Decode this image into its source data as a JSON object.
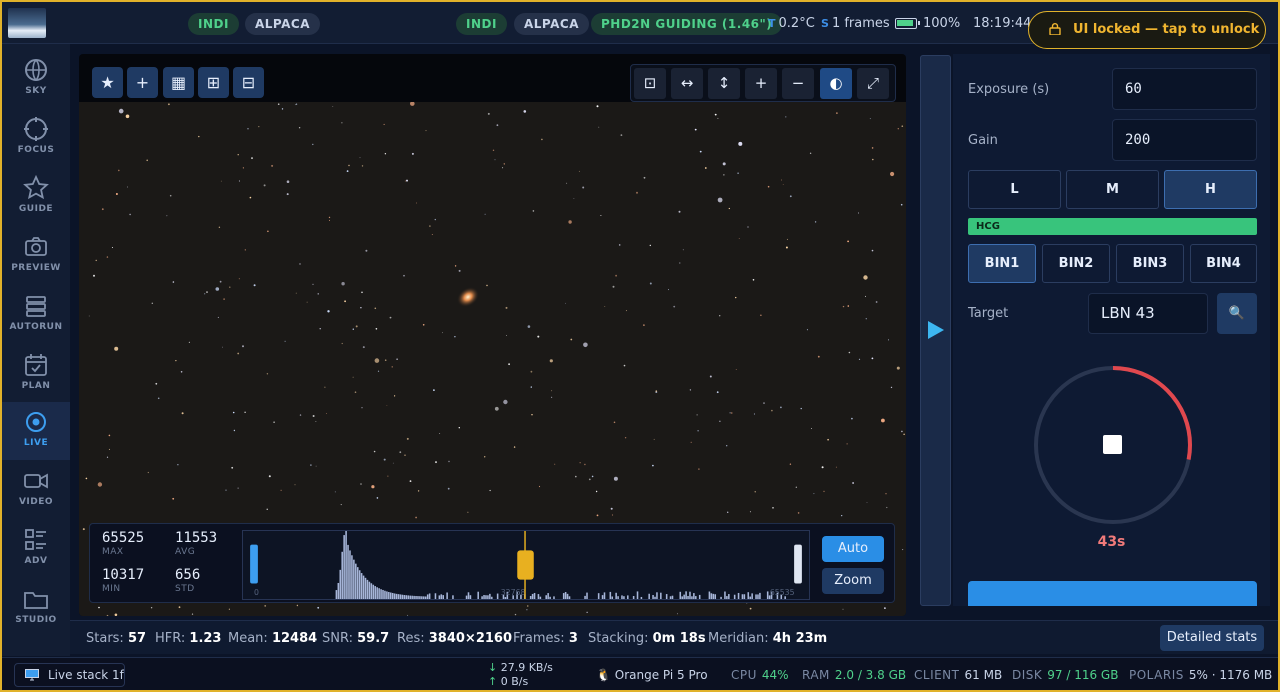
{
  "topbar": {
    "pills_left": [
      "INDI",
      "ALPACA"
    ],
    "pills_right": [
      "INDI",
      "ALPACA",
      "PHD2N GUIDING (1.46\")"
    ],
    "temp_key": "T",
    "temp": "0.2°C",
    "frames_key": "S",
    "frames": "1 frames",
    "battery": "100%",
    "time": "18:19:44",
    "lock_label": "UI locked — tap to unlock"
  },
  "sidebar": {
    "items": [
      {
        "label": "SKY",
        "icon": "globe-icon"
      },
      {
        "label": "FOCUS",
        "icon": "focus-icon"
      },
      {
        "label": "GUIDE",
        "icon": "star-icon"
      },
      {
        "label": "PREVIEW",
        "icon": "camera-icon"
      },
      {
        "label": "AUTORUN",
        "icon": "stack-icon"
      },
      {
        "label": "PLAN",
        "icon": "calendar-icon"
      },
      {
        "label": "LIVE",
        "icon": "target-icon"
      },
      {
        "label": "VIDEO",
        "icon": "video-icon"
      },
      {
        "label": "ADV",
        "icon": "list-icon"
      },
      {
        "label": "STUDIO",
        "icon": "folder-icon"
      }
    ],
    "active": "LIVE"
  },
  "image_toolbar": {
    "left": [
      "★",
      "+",
      "▦",
      "⊞",
      "⊟"
    ],
    "right": [
      "⊡",
      "↔",
      "↕",
      "+",
      "−",
      "◐",
      "⤢"
    ]
  },
  "histogram": {
    "max_value": "65525",
    "max_label": "MAX",
    "avg_value": "11553",
    "avg_label": "AVG",
    "min_value": "10317",
    "min_label": "MIN",
    "std_value": "656",
    "std_label": "STD",
    "axis_min": "0",
    "axis_mid": "32768",
    "axis_max": "65535",
    "auto_label": "Auto",
    "zoom_label": "Zoom"
  },
  "stats": {
    "stars_label": "Stars:",
    "stars": "57",
    "hfr_label": "HFR:",
    "hfr": "1.23",
    "mean_label": "Mean:",
    "mean": "12484",
    "snr_label": "SNR:",
    "snr": "59.7",
    "res_label": "Res:",
    "res": "3840×2160",
    "frames_label": "Frames:",
    "frames": "3",
    "stacking_label": "Stacking:",
    "stacking": "0m 18s",
    "meridian_label": "Meridian:",
    "meridian": "4h 23m",
    "detail_label": "Detailed stats"
  },
  "footer": {
    "live_stack": "Live stack 1f",
    "down_rate": "27.9 KB/s",
    "up_rate": "0 B/s",
    "device": "Orange Pi 5 Pro",
    "cpu_key": "CPU",
    "cpu": "44%",
    "ram_key": "RAM",
    "ram": "2.0 / 3.8 GB",
    "client_key": "CLIENT",
    "client": "61 MB",
    "disk_key": "DISK",
    "disk": "97 / 116 GB",
    "polaris_key": "POLARIS",
    "polaris": "5% · 1176 MB"
  },
  "camera": {
    "exposure_label": "Exposure (s)",
    "exposure": "60",
    "gain_label": "Gain",
    "gain": "200",
    "gain_modes": [
      "L",
      "M",
      "H"
    ],
    "gain_mode_active": "H",
    "hcg_label": "HCG",
    "bins": [
      "BIN1",
      "BIN2",
      "BIN3",
      "BIN4"
    ],
    "bin_active": "BIN1",
    "target_label": "Target",
    "target": "LBN 43",
    "countdown": "43s",
    "countdown_progress": 0.28
  },
  "colors": {
    "accent": "#3d9ef0",
    "lock": "#e1b22a",
    "ring": "#e0484e",
    "hcg": "#38c47c"
  }
}
